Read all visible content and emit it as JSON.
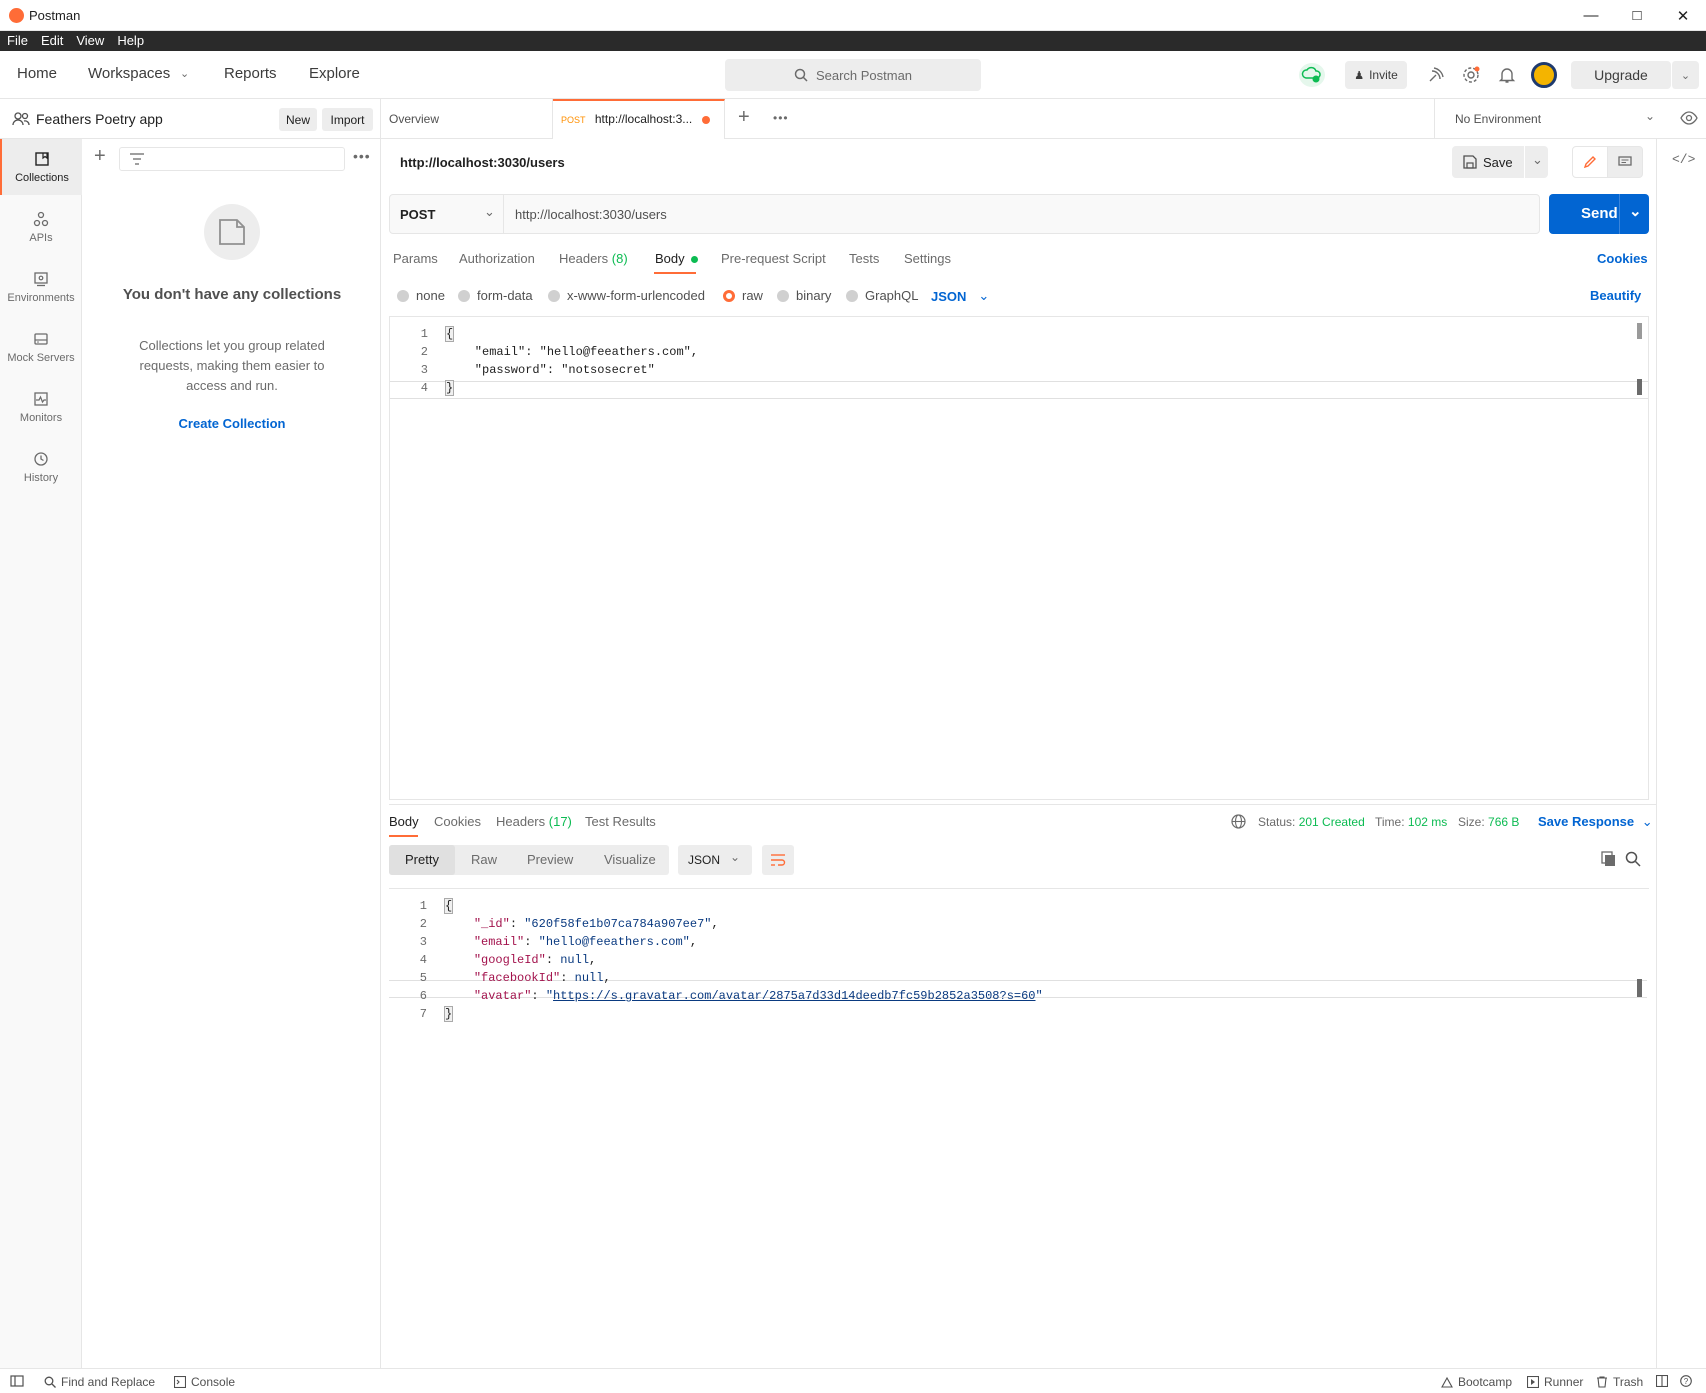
{
  "window": {
    "title": "Postman"
  },
  "menu": [
    "File",
    "Edit",
    "View",
    "Help"
  ],
  "header": {
    "nav": [
      "Home",
      "Workspaces",
      "Reports",
      "Explore"
    ],
    "search_placeholder": "Search Postman",
    "invite": "Invite",
    "upgrade": "Upgrade"
  },
  "workspace": {
    "name": "Feathers Poetry app",
    "new": "New",
    "import": "Import"
  },
  "rail": [
    "Collections",
    "APIs",
    "Environments",
    "Mock Servers",
    "Monitors",
    "History"
  ],
  "collections_empty": {
    "title": "You don't have any collections",
    "description": "Collections let you group related requests, making them easier to access and run.",
    "cta": "Create Collection"
  },
  "tabs": {
    "overview": "Overview",
    "active_method": "POST",
    "active_label": "http://localhost:3..."
  },
  "environment": "No Environment",
  "request": {
    "title": "http://localhost:3030/users",
    "save": "Save",
    "method": "POST",
    "url": "http://localhost:3030/users",
    "send": "Send",
    "tabs": [
      "Params",
      "Authorization",
      "Headers",
      "Body",
      "Pre-request Script",
      "Tests",
      "Settings"
    ],
    "headers_count": "(8)",
    "cookies": "Cookies",
    "body_modes": [
      "none",
      "form-data",
      "x-www-form-urlencoded",
      "raw",
      "binary",
      "GraphQL"
    ],
    "body_lang": "JSON",
    "beautify": "Beautify",
    "body_lines": [
      "{",
      "    \"email\": \"hello@feeathers.com\",",
      "    \"password\": \"notsosecret\"",
      "}"
    ]
  },
  "response": {
    "tabs": [
      "Body",
      "Cookies",
      "Headers",
      "Test Results"
    ],
    "headers_count": "(17)",
    "status_label": "Status:",
    "status": "201 Created",
    "time_label": "Time:",
    "time": "102 ms",
    "size_label": "Size:",
    "size": "766 B",
    "save_response": "Save Response",
    "views": [
      "Pretty",
      "Raw",
      "Preview",
      "Visualize"
    ],
    "format": "JSON",
    "lines": {
      "id_key": "\"_id\"",
      "id_val": "\"620f58fe1b07ca784a907ee7\"",
      "email_key": "\"email\"",
      "email_val": "\"hello@feeathers.com\"",
      "google_key": "\"googleId\"",
      "facebook_key": "\"facebookId\"",
      "null": "null",
      "avatar_key": "\"avatar\"",
      "avatar_url": "https://s.gravatar.com/avatar/2875a7d33d14deedb7fc59b2852a3508?s=60"
    }
  },
  "statusbar": {
    "find": "Find and Replace",
    "console": "Console",
    "bootcamp": "Bootcamp",
    "runner": "Runner",
    "trash": "Trash"
  },
  "colors": {
    "accent": "#ff6c37",
    "send": "#0265d2",
    "success": "#0cbb52"
  }
}
